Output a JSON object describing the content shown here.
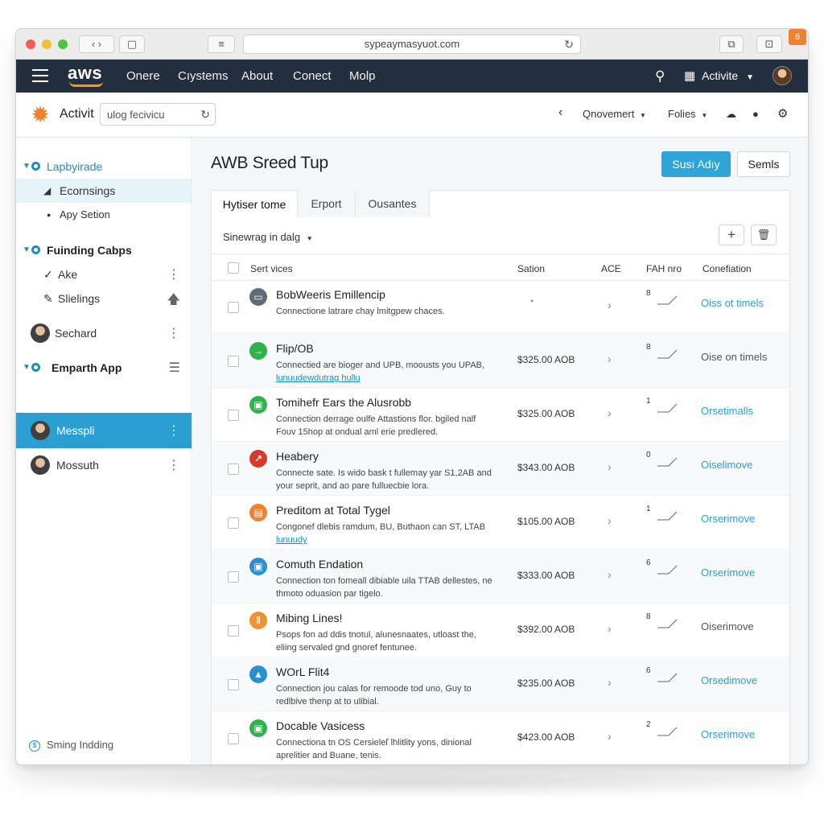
{
  "browser": {
    "url": "sypeaymasyuot.com",
    "nav_back_fwd": "‹ ›",
    "ext_badge": "6"
  },
  "topnav": {
    "logo": "aws",
    "links": [
      "Onere",
      "Cıystems",
      "About",
      "Conect",
      "Molp"
    ],
    "activity_label": "Activite"
  },
  "console_header": {
    "title": "Activit",
    "search_value": "ulog fecivicu",
    "breadcrumb": "Qnovemert",
    "policies": "Folies"
  },
  "sidebar": {
    "items": [
      {
        "label": "Lapbyirade"
      },
      {
        "label": "Ecornsings"
      },
      {
        "label": "Apy Setion"
      },
      {
        "label": "Fuinding Cabps"
      },
      {
        "label": "Ake"
      },
      {
        "label": "Slielings"
      },
      {
        "label": "Sechard"
      },
      {
        "label": "Emparth App"
      },
      {
        "label": "Messpli"
      },
      {
        "label": "Mossuth"
      }
    ],
    "footer": "Sming Indding"
  },
  "main": {
    "title": "AWB Sreed Tup",
    "primary_button": "Susı Adıy",
    "secondary_button": "Semls",
    "tabs": [
      "Hytiser tome",
      "Erport",
      "Ousantes"
    ],
    "filter": "Sinewrag in dalg",
    "columns": [
      "Sert vices",
      "Sation",
      "ACE",
      "FAH nro",
      "Conefiation"
    ]
  },
  "rows": [
    {
      "title": "BobWeeris Emillencip",
      "desc": "Connectione latrare chay lmitgpew chaces.",
      "link": "",
      "price": "",
      "num": "8",
      "status": "Oiss ot timels",
      "status_color": "#2b9fd1",
      "icon": "chat-icon",
      "icon_color": "#5f6b76",
      "glyph": "▭"
    },
    {
      "title": "Flip/OB",
      "desc": "Connectied are bioger and UPB, moousts you UPAB,",
      "link": "lunuudewdutrag hullu",
      "price": "$325.00 AOB",
      "num": "8",
      "status": "Oise on timels",
      "status_color": "#555555",
      "icon": "arrow-right-icon",
      "icon_color": "#2fb24a",
      "glyph": "→"
    },
    {
      "title": "Tomihefr Ears the Alusrobb",
      "desc": "Connection derrage oulfe Attastions flor. bgiled nalf Fouv 15hop at ondual aml erie predlered.",
      "link": "",
      "price": "$325.00 AOB",
      "num": "1",
      "status": "Orsetimalls",
      "status_color": "#2b9fd1",
      "icon": "bag-icon",
      "icon_color": "#2fb24a",
      "glyph": "▣"
    },
    {
      "title": "Heabery",
      "desc": "Connecte sate. Is wido bask t fullemay yar S1,2AB and your seprit, and ao pare fulluecbie lora.",
      "link": "",
      "price": "$343.00 AOB",
      "num": "0",
      "status": "Oiselimove",
      "status_color": "#2b9fd1",
      "icon": "chart-icon",
      "icon_color": "#d9392b",
      "glyph": "↗"
    },
    {
      "title": "Preditom at Total Tygel",
      "desc": "Congonef dlebis ramdum, BU, Buthaon can ST, LTAB",
      "link": "lunuudy",
      "price": "$105.00 AOB",
      "num": "1",
      "status": "Orserimove",
      "status_color": "#2b9fd1",
      "icon": "card-icon",
      "icon_color": "#f0822f",
      "glyph": "▤"
    },
    {
      "title": "Comuth Endation",
      "desc": "Connection ton fomeall dibiable uila TTAB dellestes, ne thmoto oduasion par tigelo.",
      "link": "",
      "price": "$333.00 AOB",
      "num": "6",
      "status": "Orserimove",
      "status_color": "#2b9fd1",
      "icon": "box-icon",
      "icon_color": "#2b8fd1",
      "glyph": "▣"
    },
    {
      "title": "Mibing Lines!",
      "desc": "Psops fon ad ddis tnotul, alunesnaates, utloast the, eliing servaled gnd gnoref fentunee.",
      "link": "",
      "price": "$392.00 AOB",
      "num": "8",
      "status": "Oiserimove",
      "status_color": "#555555",
      "icon": "bars-icon",
      "icon_color": "#f0932f",
      "glyph": "‖"
    },
    {
      "title": "WOrL Flit4",
      "desc": "Connection jou calas for remoode tod uno, Guy to redlbive thenp at to ulibial.",
      "link": "",
      "price": "$235.00 AOB",
      "num": "6",
      "status": "Orsedimove",
      "status_color": "#2b9fd1",
      "icon": "flask-icon",
      "icon_color": "#2b8fd1",
      "glyph": "▲"
    },
    {
      "title": "Docable Vasicess",
      "desc": "Connectiona tn OS Cersieleľ lhlitlity yons, dinional aprelitier and Buane, tenis.",
      "link": "",
      "price": "$423.00 AOB",
      "num": "2",
      "status": "Orserimove",
      "status_color": "#2b9fd1",
      "icon": "lock-icon",
      "icon_color": "#2fb24a",
      "glyph": "▣"
    }
  ]
}
